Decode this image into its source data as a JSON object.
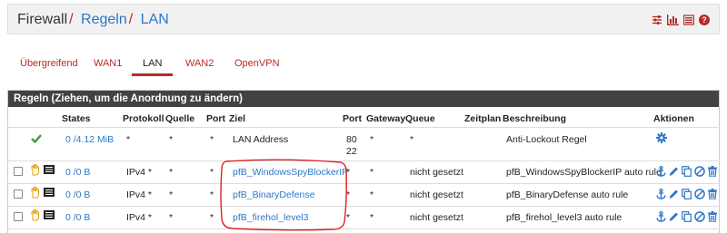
{
  "breadcrumb": {
    "root": "Firewall",
    "section": "Regeln",
    "current": "LAN"
  },
  "header_icons": [
    "sliders-icon",
    "bar-chart-icon",
    "list-icon",
    "help-icon"
  ],
  "tabs": [
    {
      "label": "Übergreifend",
      "active": false
    },
    {
      "label": "WAN1",
      "active": false
    },
    {
      "label": "LAN",
      "active": true
    },
    {
      "label": "WAN2",
      "active": false
    },
    {
      "label": "OpenVPN",
      "active": false
    }
  ],
  "panel": {
    "title": "Regeln (Ziehen, um die Anordnung zu ändern)"
  },
  "columns": {
    "states": "States",
    "protocol": "Protokoll",
    "source": "Quelle",
    "port": "Port",
    "dest": "Ziel",
    "dport": "Port",
    "gateway": "Gateway",
    "queue": "Queue",
    "schedule": "Zeitplan",
    "description": "Beschreibung",
    "actions": "Aktionen"
  },
  "antilockout": {
    "states": "0 /4.12 MiB",
    "protocol": "*",
    "source": "*",
    "port": "*",
    "dest": "LAN Address",
    "dport1": "80",
    "dport2": "22",
    "gateway": "*",
    "queue": "*",
    "description": "Anti-Lockout Regel"
  },
  "rules": [
    {
      "states": "0 /0 B",
      "protocol": "IPv4 *",
      "source": "*",
      "port": "*",
      "dest": "pfB_WindowsSpyBlockerIP",
      "dport": "*",
      "gateway": "*",
      "queue": "nicht gesetzt",
      "schedule": "",
      "description": "pfB_WindowsSpyBlockerIP auto rule"
    },
    {
      "states": "0 /0 B",
      "protocol": "IPv4 *",
      "source": "*",
      "port": "*",
      "dest": "pfB_BinaryDefense",
      "dport": "*",
      "gateway": "*",
      "queue": "nicht gesetzt",
      "schedule": "",
      "description": "pfB_BinaryDefense auto rule"
    },
    {
      "states": "0 /0 B",
      "protocol": "IPv4 *",
      "source": "*",
      "port": "*",
      "dest": "pfB_firehol_level3",
      "dport": "*",
      "gateway": "*",
      "queue": "nicht gesetzt",
      "schedule": "",
      "description": "pfB_firehol_level3 auto rule"
    }
  ],
  "colors": {
    "link": "#2d77c7",
    "accent": "#b52b27",
    "panel_heading": "#424242",
    "pass": "#3a9b3a",
    "annotation": "#e02020"
  }
}
